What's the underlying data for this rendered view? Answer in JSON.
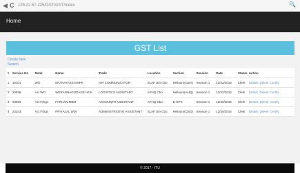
{
  "browser": {
    "back": "◀",
    "reload": "C",
    "url": "135.22.67.225/GST/GST/Index",
    "extension": "🔍"
  },
  "nav": {
    "brand": "Home"
  },
  "page": {
    "title": "GST List",
    "create_link": "Create New",
    "search_link": "Search"
  },
  "table": {
    "headers": [
      "#",
      "Service No",
      "Rank",
      "Name",
      "Trade",
      "Location",
      "Section",
      "Session",
      "Date",
      "Status",
      "Action"
    ],
    "rows": [
      [
        "1",
        "19101",
        "WO",
        "EKANAYAKE EMPK",
        "AIR COMMUNICATOR",
        "SLAF Stn Cbo",
        "Hellours(CBO)",
        "Session 1",
        "12/22/2016",
        "Clerk"
      ],
      [
        "2",
        "20038",
        "Act WO",
        "WERANNAGODAGE HCK",
        "LOGISTICS ASSISTANT",
        "AFHQ Cbo",
        "Hellours(AHQ)",
        "Session 1",
        "12/22/2016",
        "Clerk"
      ],
      [
        "3",
        "23026",
        "Act F/Sgt",
        "FARHAN MBM",
        "ACCOUNTS ASSISTANT",
        "AFHQ Cbo",
        "D OPS",
        "Session 1",
        "12/20/2016",
        "Clerk"
      ],
      [
        "4",
        "23243",
        "Act F/Sgt",
        "PRIYALAL WDI",
        "ADMINISTRATIVE ASSISTANT",
        "SLAF Stn Cbo",
        "Hellours(CBO)",
        "Session 1",
        "12/20/2016",
        "Clerk"
      ]
    ],
    "actions": [
      "Details",
      "Delete",
      "Certify"
    ]
  },
  "footer": {
    "text": "© 2017 - ITU"
  }
}
